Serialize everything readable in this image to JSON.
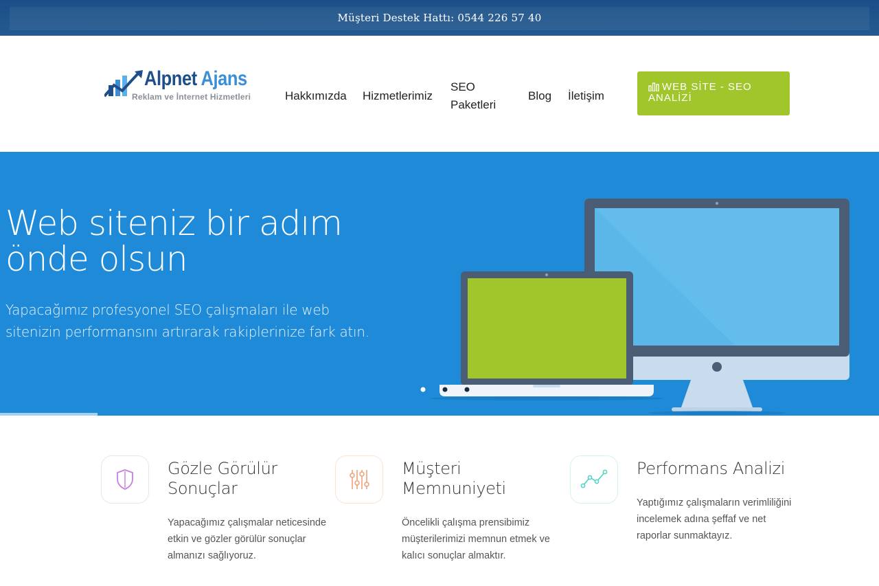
{
  "topbar": {
    "text": "Müşteri Destek Hattı: 0544 226 57 40"
  },
  "logo": {
    "title_a": "Alpnet",
    "title_b": "Ajans",
    "subtitle": "Reklam ve İnternet Hizmetleri"
  },
  "nav": {
    "items": [
      {
        "label": "Hakkımızda"
      },
      {
        "label": "Hizmetlerimiz"
      },
      {
        "label": "SEO Paketleri"
      },
      {
        "label": "Blog"
      },
      {
        "label": "İletişim"
      }
    ]
  },
  "cta": {
    "label": "WEB SİTE - SEO ANALİZİ",
    "icon": "bar-chart-icon",
    "color": "#a1c62c"
  },
  "hero": {
    "title": "Web siteniz bir adım önde olsun",
    "description": "Yapacağımız profesyonel SEO çalışmaları ile web sitenizin performansını artırarak rakiplerinize fark atın.",
    "background": "#1e8ad8",
    "laptop_screen_color": "#a1c62c"
  },
  "features": [
    {
      "icon": "shield-icon",
      "accent": "#c67ee0",
      "title": "Gözle Görülür Sonuçlar",
      "description": "Yapacağımız çalışmalar neticesinde etkin ve gözler görülür sonuçlar almanızı sağlıyoruz."
    },
    {
      "icon": "sliders-icon",
      "accent": "#f0a27a",
      "title": "Müşteri Memnuniyeti",
      "description": "Öncelikli çalışma prensibimiz müşterilerimizi memnun etmek ve kalıcı sonuçlar almaktır."
    },
    {
      "icon": "line-chart-icon",
      "accent": "#4fd0c4",
      "title": "Performans Analizi",
      "description": "Yaptığımız çalışmaların verimliliğini incelemek adına şeffaf ve net raporlar sunmaktayız."
    }
  ]
}
